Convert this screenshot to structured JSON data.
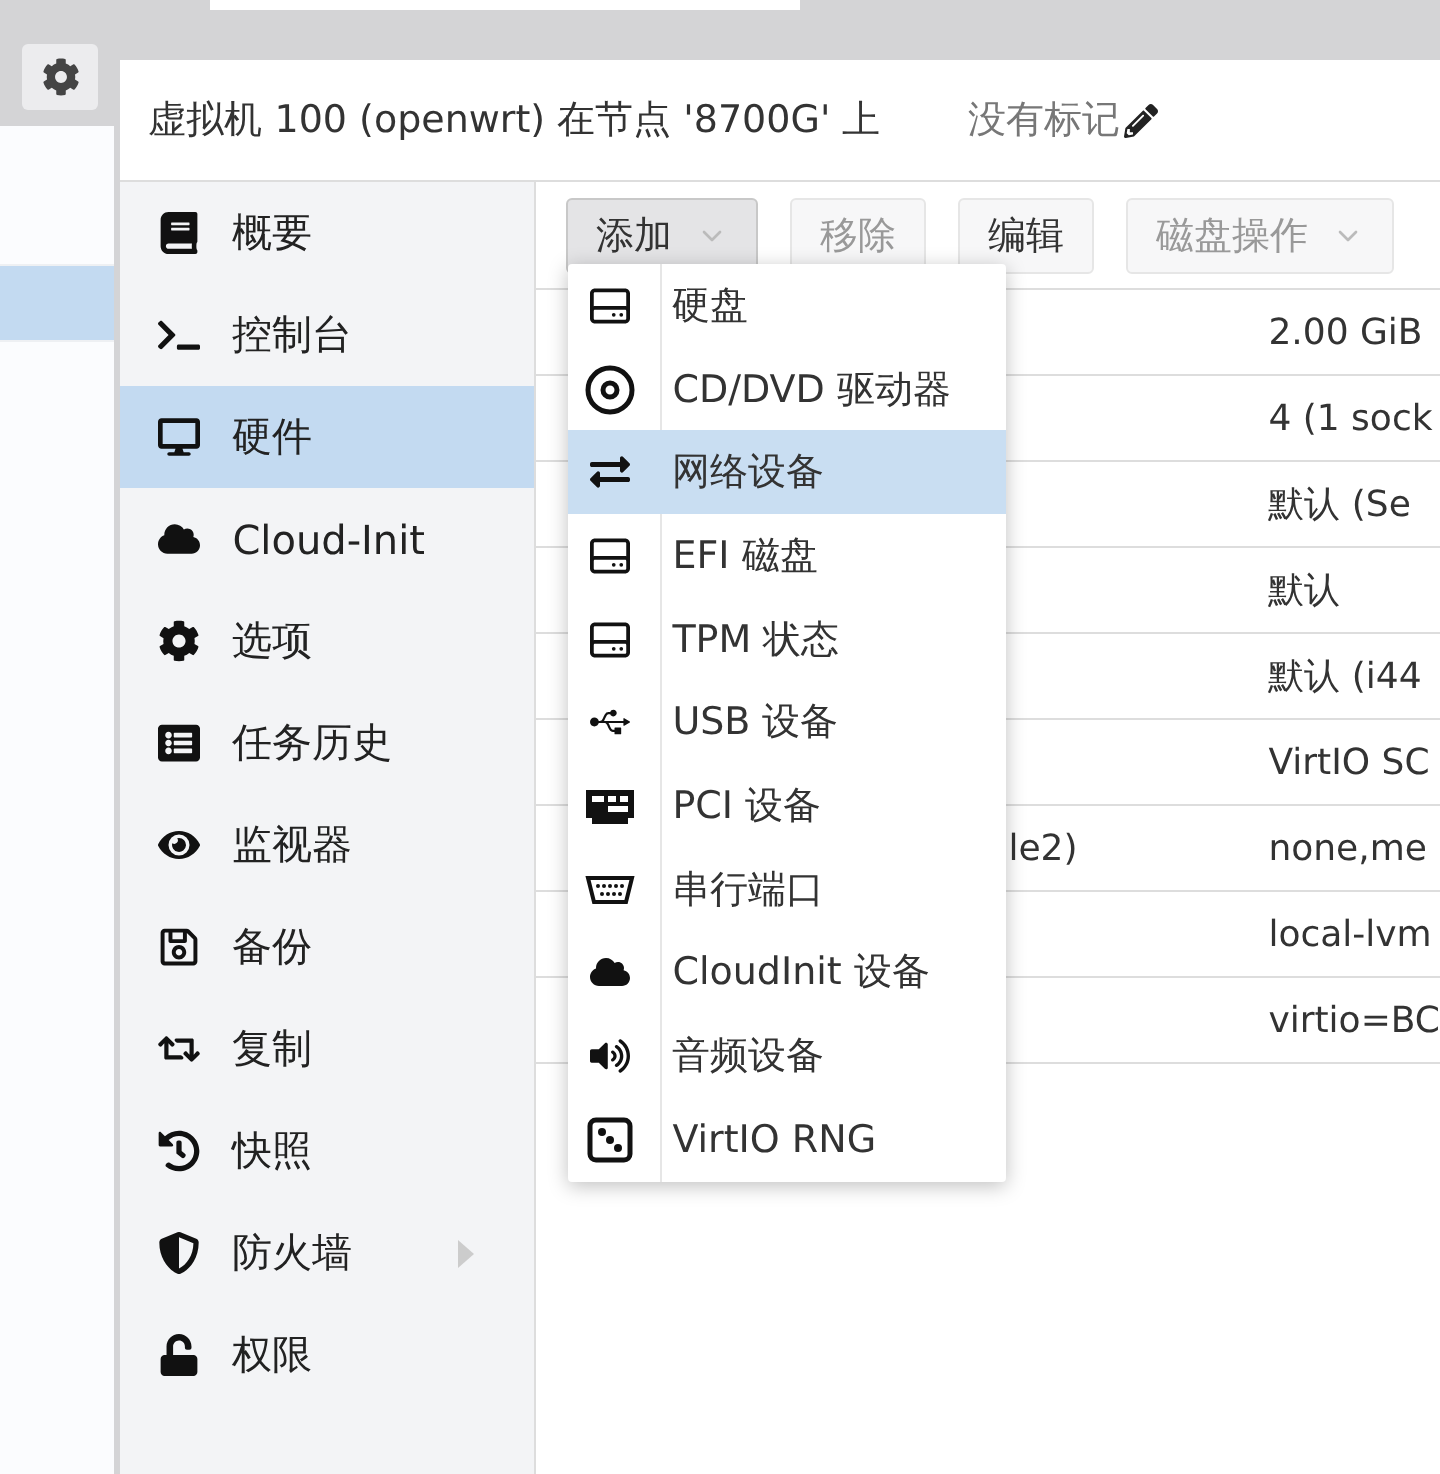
{
  "header": {
    "title": "虚拟机 100 (openwrt) 在节点 '8700G' 上",
    "tags": "没有标记"
  },
  "nav": [
    {
      "label": "概要",
      "selected": false,
      "expandable": false
    },
    {
      "label": "控制台",
      "selected": false,
      "expandable": false
    },
    {
      "label": "硬件",
      "selected": true,
      "expandable": false
    },
    {
      "label": "Cloud-Init",
      "selected": false,
      "expandable": false
    },
    {
      "label": "选项",
      "selected": false,
      "expandable": false
    },
    {
      "label": "任务历史",
      "selected": false,
      "expandable": false
    },
    {
      "label": "监视器",
      "selected": false,
      "expandable": false
    },
    {
      "label": "备份",
      "selected": false,
      "expandable": false
    },
    {
      "label": "复制",
      "selected": false,
      "expandable": false
    },
    {
      "label": "快照",
      "selected": false,
      "expandable": false
    },
    {
      "label": "防火墙",
      "selected": false,
      "expandable": true
    },
    {
      "label": "权限",
      "selected": false,
      "expandable": false
    }
  ],
  "toolbar": [
    {
      "label": "添加",
      "disabled": false,
      "pressed": true,
      "dropdown": true
    },
    {
      "label": "移除",
      "disabled": true,
      "pressed": false,
      "dropdown": false
    },
    {
      "label": "编辑",
      "disabled": false,
      "pressed": false,
      "dropdown": false
    },
    {
      "label": "磁盘操作",
      "disabled": true,
      "pressed": false,
      "dropdown": true
    }
  ],
  "table": {
    "rows": [
      {
        "column_2": "",
        "value": "2.00 GiB"
      },
      {
        "column_2": "",
        "value": "4 (1 sock"
      },
      {
        "column_2": "",
        "value": "默认 (Se"
      },
      {
        "column_2": "",
        "value": "默认"
      },
      {
        "column_2": "",
        "value": "默认 (i44"
      },
      {
        "column_2": "",
        "value": "VirtIO SC"
      },
      {
        "column_2": "le2)",
        "value": "none,me"
      },
      {
        "column_2": "",
        "value": "local-lvm"
      },
      {
        "column_2": "",
        "value": "virtio=BC"
      }
    ]
  },
  "add_menu": [
    {
      "label": "硬盘",
      "selected": false
    },
    {
      "label": "CD/DVD 驱动器",
      "selected": false
    },
    {
      "label": "网络设备",
      "selected": true
    },
    {
      "label": "EFI 磁盘",
      "selected": false
    },
    {
      "label": "TPM 状态",
      "selected": false
    },
    {
      "label": "USB 设备",
      "selected": false
    },
    {
      "label": "PCI 设备",
      "selected": false
    },
    {
      "label": "串行端口",
      "selected": false
    },
    {
      "label": "CloudInit 设备",
      "selected": false
    },
    {
      "label": "音频设备",
      "selected": false
    },
    {
      "label": "VirtIO RNG",
      "selected": false
    }
  ],
  "left_panel": {
    "rows": [
      {
        "selected": false
      },
      {
        "selected": true
      }
    ]
  }
}
